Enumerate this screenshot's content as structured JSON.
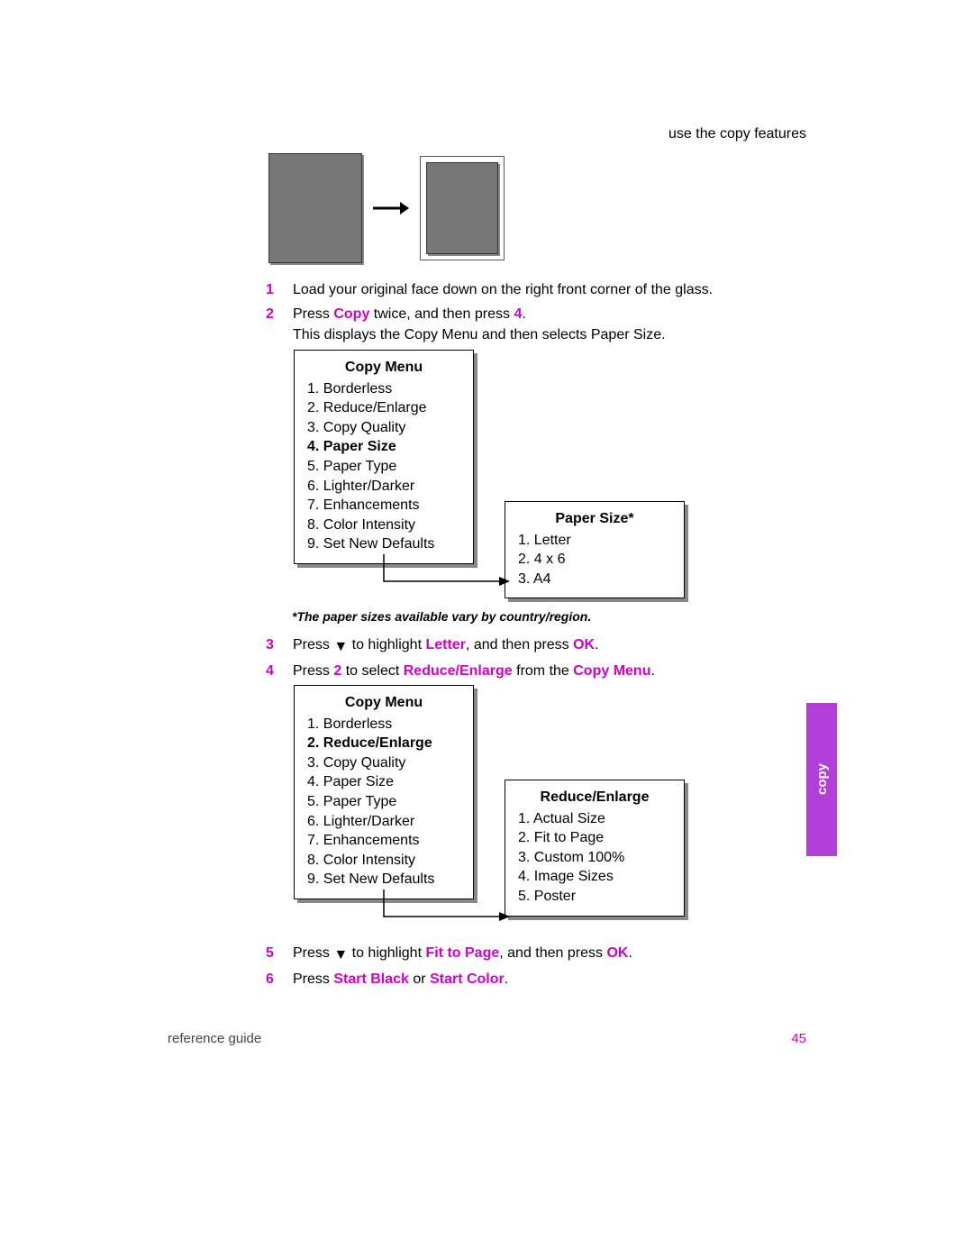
{
  "header": {
    "section": "use the copy features"
  },
  "steps": {
    "s1": {
      "num": "1",
      "text": "Load your original face down on the right front corner of the glass."
    },
    "s2": {
      "num": "2",
      "prefix": "Press ",
      "copy": "Copy",
      "mid": " twice, and then press ",
      "four": "4",
      "period": ".",
      "sub": "This displays the Copy Menu and then selects Paper Size."
    },
    "s3": {
      "num": "3",
      "a": "Press ",
      "b": " to highlight ",
      "letter": "Letter",
      "c": ", and then press ",
      "ok": "OK",
      "d": "."
    },
    "s4": {
      "num": "4",
      "a": "Press ",
      "two": "2",
      "b": " to select ",
      "re": "Reduce/Enlarge",
      "c": " from the ",
      "cm": "Copy Menu",
      "d": "."
    },
    "s5": {
      "num": "5",
      "a": "Press ",
      "b": " to highlight ",
      "fit": "Fit to Page",
      "c": ", and then press ",
      "ok": "OK",
      "d": "."
    },
    "s6": {
      "num": "6",
      "a": "Press ",
      "sb": "Start Black",
      "b": " or ",
      "sc": "Start Color",
      "c": "."
    }
  },
  "menu1": {
    "title": "Copy Menu",
    "i1": "1. Borderless",
    "i2": "2. Reduce/Enlarge",
    "i3": "3. Copy Quality",
    "i4": "4. Paper Size",
    "i5": "5. Paper Type",
    "i6": "6. Lighter/Darker",
    "i7": "7. Enhancements",
    "i8": "8. Color Intensity",
    "i9": "9. Set New Defaults"
  },
  "menu2": {
    "title": "Paper Size*",
    "i1": "1. Letter",
    "i2": "2. 4 x 6",
    "i3": "3. A4"
  },
  "menu3": {
    "title": "Copy Menu",
    "i1": "1. Borderless",
    "i2": "2. Reduce/Enlarge",
    "i3": "3. Copy Quality",
    "i4": "4. Paper Size",
    "i5": "5. Paper Type",
    "i6": "6. Lighter/Darker",
    "i7": "7. Enhancements",
    "i8": "8. Color Intensity",
    "i9": "9. Set New Defaults"
  },
  "menu4": {
    "title": "Reduce/Enlarge",
    "i1": "1. Actual Size",
    "i2": "2. Fit to Page",
    "i3": "3. Custom 100%",
    "i4": "4. Image Sizes",
    "i5": "5. Poster"
  },
  "note": "*The paper sizes available vary by country/region.",
  "tab": "copy",
  "footer": {
    "left": "reference guide",
    "right": "45"
  }
}
